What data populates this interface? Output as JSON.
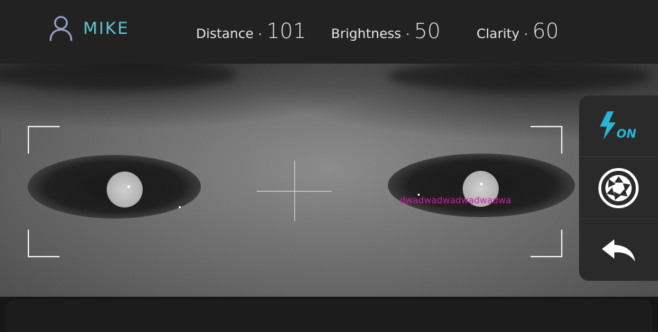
{
  "header": {
    "user_name": "MIKE",
    "metrics": [
      {
        "label": "Distance",
        "separator": "·",
        "value": "101"
      },
      {
        "label": "Brightness",
        "separator": "·",
        "value": "50"
      },
      {
        "label": "Clarity",
        "separator": "·",
        "value": "60"
      }
    ]
  },
  "viewport": {
    "overlay_text": "dwadwadwadwadwadwa"
  },
  "side_panel": {
    "flash_state": "ON",
    "buttons": [
      "flash-icon",
      "shutter-icon",
      "back-arrow-icon"
    ]
  },
  "colors": {
    "accent": "#5fc7d6",
    "overlay_text": "#d21ba6",
    "panel": "#2a2a2b"
  }
}
